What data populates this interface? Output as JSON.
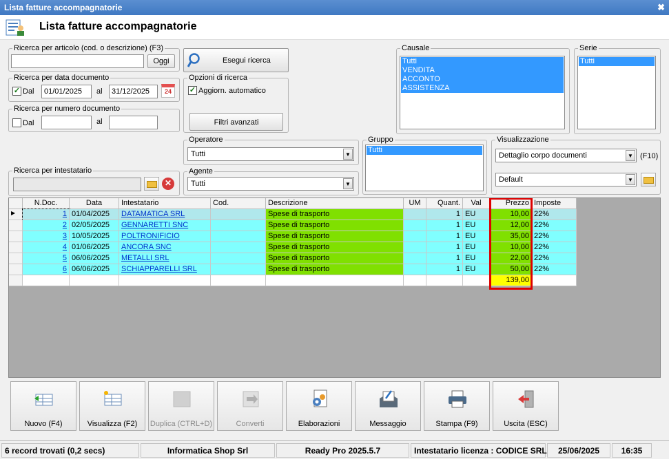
{
  "window": {
    "title": "Lista fatture accompagnatorie",
    "header_title": "Lista fatture accompagnatorie"
  },
  "search_article": {
    "legend": "Ricerca per articolo (cod. o descrizione) (F3)",
    "value": "",
    "today_btn": "Oggi"
  },
  "search_btn": "Esegui ricerca",
  "search_date": {
    "legend": "Ricerca per data documento",
    "from_label": "Dal",
    "from": "01/01/2025",
    "to_label": "al",
    "to": "31/12/2025",
    "cal_day": "24",
    "checked": true
  },
  "search_number": {
    "legend": "Ricerca per numero documento",
    "from_label": "Dal",
    "to_label": "al",
    "checked": false
  },
  "search_options": {
    "legend": "Opzioni di ricerca",
    "auto_label": "Aggiorn. automatico",
    "checked": true,
    "advanced_btn": "Filtri avanzati"
  },
  "causale": {
    "legend": "Causale",
    "items": [
      "Tutti",
      "VENDITA",
      "ACCONTO",
      "ASSISTENZA"
    ]
  },
  "serie": {
    "legend": "Serie",
    "items": [
      "Tutti"
    ]
  },
  "operatore": {
    "legend": "Operatore",
    "value": "Tutti"
  },
  "agente": {
    "legend": "Agente",
    "value": "Tutti"
  },
  "gruppo": {
    "legend": "Gruppo",
    "items": [
      "Tutti"
    ]
  },
  "visualizzazione": {
    "legend": "Visualizzazione",
    "mode": "Dettaglio corpo documenti",
    "shortcut": "(F10)",
    "layout": "Default"
  },
  "intestatario": {
    "legend": "Ricerca per intestatario",
    "value": ""
  },
  "grid": {
    "columns": [
      "",
      "N.Doc.",
      "Data",
      "Intestatario",
      "Cod.",
      "Descrizione",
      "UM",
      "Quant.",
      "Val",
      "Prezzo",
      "Imposte"
    ],
    "rows": [
      {
        "n": "1",
        "data": "01/04/2025",
        "intestatario": "DATAMATICA SRL",
        "cod": "",
        "descrizione": "Spese di trasporto",
        "um": "",
        "quant": "1",
        "val": "EU",
        "prezzo": "10,00",
        "imposte": "22%"
      },
      {
        "n": "2",
        "data": "02/05/2025",
        "intestatario": "GENNARETTI SNC",
        "cod": "",
        "descrizione": "Spese di trasporto",
        "um": "",
        "quant": "1",
        "val": "EU",
        "prezzo": "12,00",
        "imposte": "22%"
      },
      {
        "n": "3",
        "data": "10/05/2025",
        "intestatario": "POLTRONIFICIO ",
        "cod": "",
        "descrizione": "Spese di trasporto",
        "um": "",
        "quant": "1",
        "val": "EU",
        "prezzo": "35,00",
        "imposte": "22%"
      },
      {
        "n": "4",
        "data": "01/06/2025",
        "intestatario": "ANCORA SNC",
        "cod": "",
        "descrizione": "Spese di trasporto",
        "um": "",
        "quant": "1",
        "val": "EU",
        "prezzo": "10,00",
        "imposte": "22%"
      },
      {
        "n": "5",
        "data": "06/06/2025",
        "intestatario": "METALLI SRL",
        "cod": "",
        "descrizione": "Spese di trasporto",
        "um": "",
        "quant": "1",
        "val": "EU",
        "prezzo": "22,00",
        "imposte": "22%"
      },
      {
        "n": "6",
        "data": "06/06/2025",
        "intestatario": "SCHIAPPARELLI SRL",
        "cod": "",
        "descrizione": "Spese di trasporto",
        "um": "",
        "quant": "1",
        "val": "EU",
        "prezzo": "50,00",
        "imposte": "22%"
      }
    ],
    "total": "139,00"
  },
  "toolbar": [
    {
      "label": "Nuovo (F4)",
      "icon": "new-document-icon",
      "enabled": true
    },
    {
      "label": "Visualizza (F2)",
      "icon": "view-grid-icon",
      "enabled": true
    },
    {
      "label": "Duplica (CTRL+D)",
      "icon": "duplicate-icon",
      "enabled": false
    },
    {
      "label": "Converti",
      "icon": "convert-icon",
      "enabled": false
    },
    {
      "label": "Elaborazioni",
      "icon": "gear-document-icon",
      "enabled": true
    },
    {
      "label": "Messaggio",
      "icon": "message-icon",
      "enabled": true
    },
    {
      "label": "Stampa (F9)",
      "icon": "printer-icon",
      "enabled": true
    },
    {
      "label": "Uscita (ESC)",
      "icon": "exit-door-icon",
      "enabled": true
    }
  ],
  "status": {
    "records": "6 record trovati (0,2 secs)",
    "company": "Informatica Shop Srl",
    "product": "Ready Pro 2025.5.7",
    "license": "Intestatario licenza : CODICE SRL",
    "date": "25/06/2025",
    "time": "16:35"
  },
  "colors": {
    "cyan_row": "#80ffff",
    "selected_row": "#b0e8ec",
    "green_cell": "#80e000",
    "total_yellow": "#ffff00",
    "highlight_border": "#dd0000",
    "title_blue": "#3f78c2",
    "list_select": "#3399ff"
  }
}
